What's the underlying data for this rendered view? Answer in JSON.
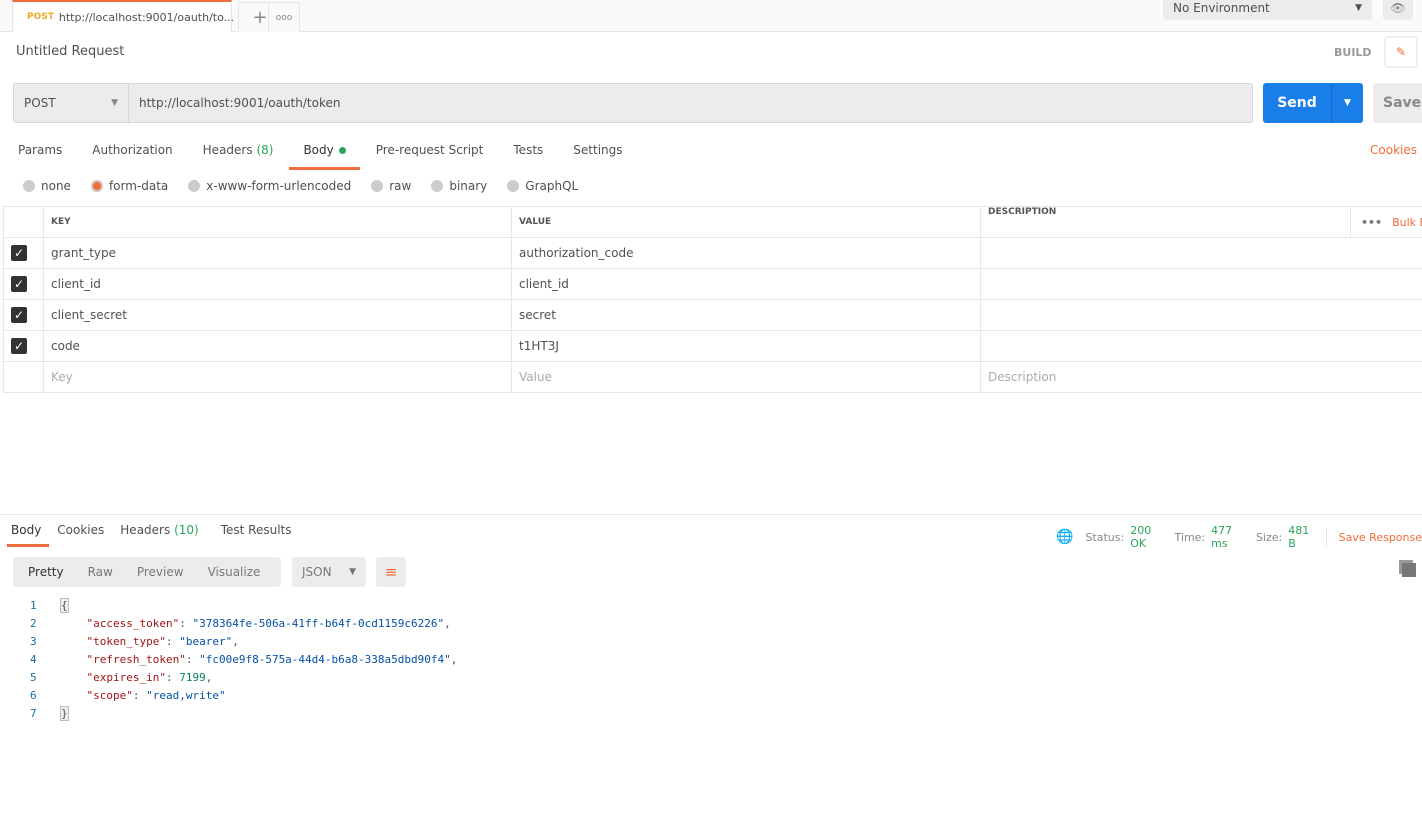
{
  "tabs": [
    {
      "method": "POST",
      "label": "http://localhost:9001/oauth/to..."
    }
  ],
  "environment": "No Environment",
  "request": {
    "title": "Untitled Request",
    "build_label": "BUILD",
    "method": "POST",
    "url": "http://localhost:9001/oauth/token",
    "send_label": "Send",
    "save_label": "Save"
  },
  "req_tabs": {
    "params": "Params",
    "authorization": "Authorization",
    "headers": "Headers",
    "headers_count": "(8)",
    "body": "Body",
    "prerequest": "Pre-request Script",
    "tests": "Tests",
    "settings": "Settings",
    "cookies": "Cookies"
  },
  "body_types": [
    "none",
    "form-data",
    "x-www-form-urlencoded",
    "raw",
    "binary",
    "GraphQL"
  ],
  "selected_body_type": "form-data",
  "form": {
    "headers": {
      "key": "KEY",
      "value": "VALUE",
      "description": "DESCRIPTION",
      "bulk": "Bulk Edit"
    },
    "rows": [
      {
        "key": "grant_type",
        "value": "authorization_code",
        "checked": true
      },
      {
        "key": "client_id",
        "value": "client_id",
        "checked": true
      },
      {
        "key": "client_secret",
        "value": "secret",
        "checked": true
      },
      {
        "key": "code",
        "value": "t1HT3J",
        "checked": true
      }
    ],
    "placeholders": {
      "key": "Key",
      "value": "Value",
      "description": "Description"
    }
  },
  "response": {
    "tabs": {
      "body": "Body",
      "cookies": "Cookies",
      "headers": "Headers",
      "headers_count": "(10)",
      "tests": "Test Results"
    },
    "status_label": "Status:",
    "status": "200 OK",
    "time_label": "Time:",
    "time": "477 ms",
    "size_label": "Size:",
    "size": "481 B",
    "save": "Save Response",
    "formats": [
      "Pretty",
      "Raw",
      "Preview",
      "Visualize"
    ],
    "language": "JSON",
    "lines": [
      [
        "1",
        "{"
      ],
      [
        "2",
        "\"access_token\"",
        "\"378364fe-506a-41ff-b64f-0cd1159c6226\""
      ],
      [
        "3",
        "\"token_type\"",
        "\"bearer\""
      ],
      [
        "4",
        "\"refresh_token\"",
        "\"fc00e9f8-575a-44d4-b6a8-338a5dbd90f4\""
      ],
      [
        "5",
        "\"expires_in\"",
        "7199"
      ],
      [
        "6",
        "\"scope\"",
        "\"read,write\""
      ],
      [
        "7",
        "}"
      ]
    ]
  },
  "colors": {
    "accent": "#f26b3a",
    "send": "#1a7ee8",
    "success": "#2aa55b"
  }
}
